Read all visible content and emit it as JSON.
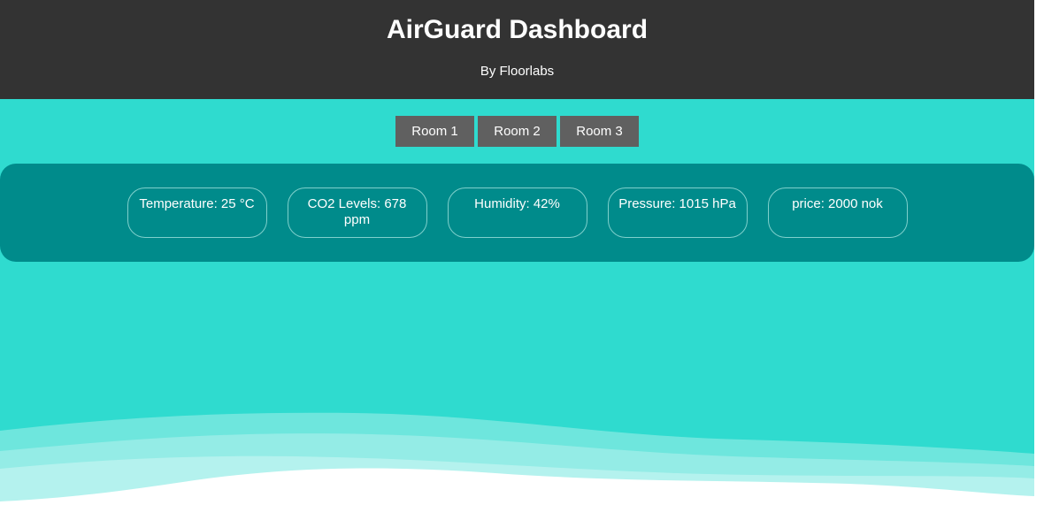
{
  "header": {
    "title": "AirGuard Dashboard",
    "subtitle": "By Floorlabs"
  },
  "tabs": [
    {
      "label": "Room 1"
    },
    {
      "label": "Room 2"
    },
    {
      "label": "Room 3"
    }
  ],
  "metrics": [
    {
      "label": "Temperature: 25 °C"
    },
    {
      "label": "CO2 Levels: 678 ppm"
    },
    {
      "label": "Humidity: 42%"
    },
    {
      "label": "Pressure: 1015 hPa"
    },
    {
      "label": "price: 2000 nok"
    }
  ],
  "colors": {
    "header_bg": "#333333",
    "page_bg": "#2fdbcf",
    "panel_bg": "#008b8b",
    "tab_bg": "#606060",
    "text": "#ffffff"
  }
}
